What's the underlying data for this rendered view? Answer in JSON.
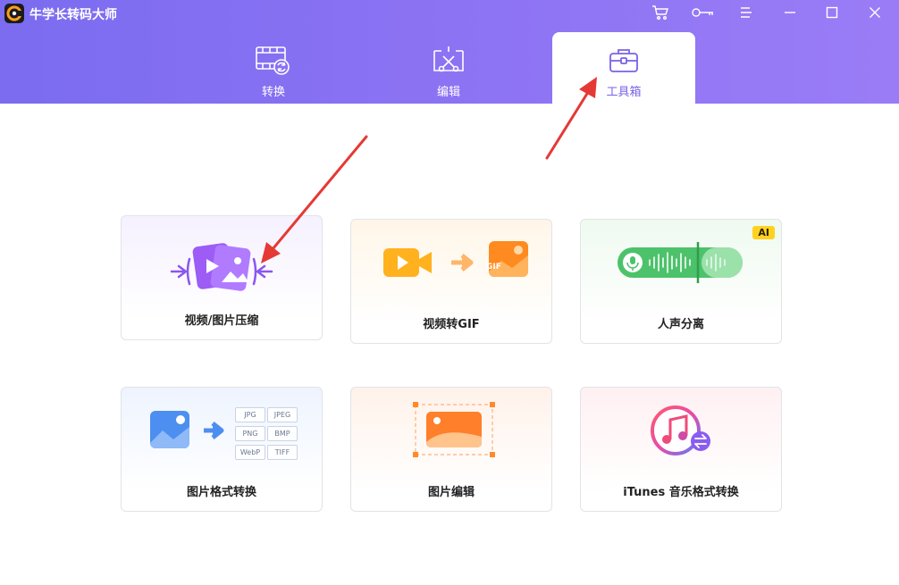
{
  "app": {
    "title": "牛学长转码大师",
    "logo_icon": "c-logo-icon",
    "accent_color": "#7b6cf0"
  },
  "window_controls": [
    {
      "name": "cart-icon"
    },
    {
      "name": "key-icon"
    },
    {
      "name": "menu-icon"
    },
    {
      "name": "minimize-icon"
    },
    {
      "name": "maximize-icon"
    },
    {
      "name": "close-icon"
    }
  ],
  "tabs": [
    {
      "label": "转换",
      "icon": "film-convert-icon",
      "active": false
    },
    {
      "label": "编辑",
      "icon": "edit-cut-icon",
      "active": false
    },
    {
      "label": "工具箱",
      "icon": "toolbox-icon",
      "active": true
    }
  ],
  "tools": [
    {
      "label": "视频/图片压缩",
      "icon": "compress-icon"
    },
    {
      "label": "视频转GIF",
      "icon": "video-to-gif-icon",
      "art_text": "GIF"
    },
    {
      "label": "人声分离",
      "icon": "voice-separation-icon",
      "badge": "AI"
    },
    {
      "label": "图片格式转换",
      "icon": "image-format-icon",
      "formats": [
        "JPG",
        "JPEG",
        "PNG",
        "BMP",
        "WebP",
        "TIFF"
      ]
    },
    {
      "label": "图片编辑",
      "icon": "image-edit-icon"
    },
    {
      "label": "iTunes 音乐格式转换",
      "icon": "itunes-convert-icon"
    }
  ]
}
